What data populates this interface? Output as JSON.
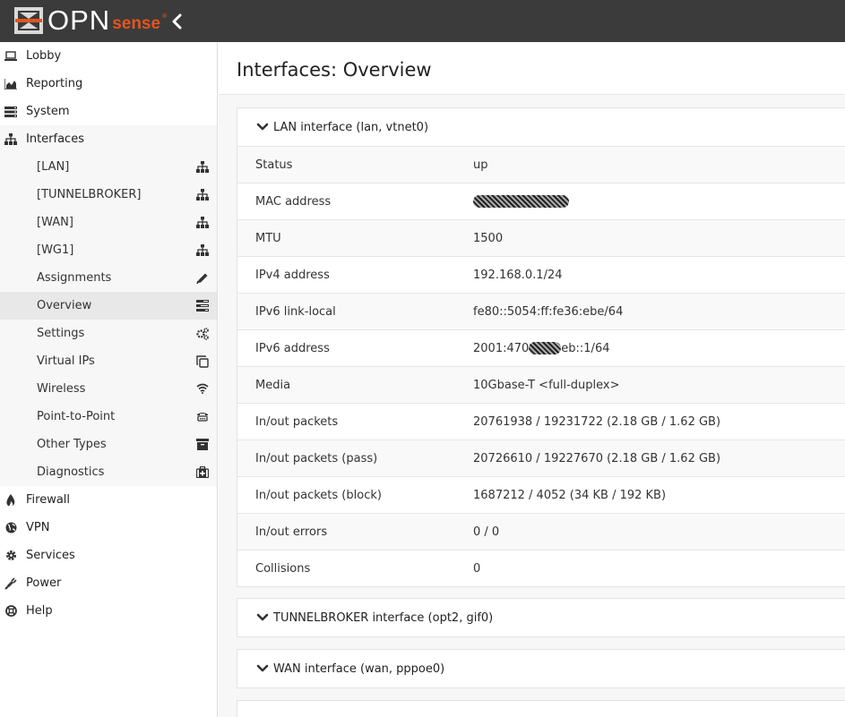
{
  "brand": {
    "name_primary": "OPN",
    "name_secondary": "sense",
    "registered_mark": "®",
    "accent_color": "#e2551f"
  },
  "topbar": {
    "collapse_icon": "chevron-left-icon"
  },
  "sidebar": {
    "items": [
      {
        "label": "Lobby",
        "icon": "laptop-icon"
      },
      {
        "label": "Reporting",
        "icon": "area-chart-icon"
      },
      {
        "label": "System",
        "icon": "server-icon"
      },
      {
        "label": "Interfaces",
        "icon": "sitemap-icon"
      },
      {
        "label": "Firewall",
        "icon": "fire-icon"
      },
      {
        "label": "VPN",
        "icon": "globe-icon"
      },
      {
        "label": "Services",
        "icon": "gear-icon"
      },
      {
        "label": "Power",
        "icon": "plug-icon"
      },
      {
        "label": "Help",
        "icon": "life-ring-icon"
      }
    ],
    "interfaces_sub": [
      {
        "label": "[LAN]",
        "icon": "sitemap-icon"
      },
      {
        "label": "[TUNNELBROKER]",
        "icon": "sitemap-icon"
      },
      {
        "label": "[WAN]",
        "icon": "sitemap-icon"
      },
      {
        "label": "[WG1]",
        "icon": "sitemap-icon"
      },
      {
        "label": "Assignments",
        "icon": "pencil-icon"
      },
      {
        "label": "Overview",
        "icon": "tasks-icon"
      },
      {
        "label": "Settings",
        "icon": "gears-icon"
      },
      {
        "label": "Virtual IPs",
        "icon": "clone-icon"
      },
      {
        "label": "Wireless",
        "icon": "wifi-icon"
      },
      {
        "label": "Point-to-Point",
        "icon": "phone-icon"
      },
      {
        "label": "Other Types",
        "icon": "archive-icon"
      },
      {
        "label": "Diagnostics",
        "icon": "medkit-icon"
      }
    ]
  },
  "main": {
    "title": "Interfaces: Overview",
    "panels": [
      {
        "title": "LAN interface (lan, vtnet0)",
        "expanded": true,
        "rows": [
          {
            "label": "Status",
            "value": "up"
          },
          {
            "label": "MAC address",
            "value": ""
          },
          {
            "label": "MTU",
            "value": "1500"
          },
          {
            "label": "IPv4 address",
            "value": "192.168.0.1/24"
          },
          {
            "label": "IPv6 link-local",
            "value": "fe80::5054:ff:fe36:ebe/64"
          },
          {
            "label": "IPv6 address",
            "value_prefix": "2001:470",
            "value_suffix": "eb::1/64"
          },
          {
            "label": "Media",
            "value": "10Gbase-T <full-duplex>"
          },
          {
            "label": "In/out packets",
            "value": "20761938 / 19231722 (2.18 GB / 1.62 GB)"
          },
          {
            "label": "In/out packets (pass)",
            "value": "20726610 / 19227670 (2.18 GB / 1.62 GB)"
          },
          {
            "label": "In/out packets (block)",
            "value": "1687212 / 4052 (34 KB / 192 KB)"
          },
          {
            "label": "In/out errors",
            "value": "0 / 0"
          },
          {
            "label": "Collisions",
            "value": "0"
          }
        ]
      },
      {
        "title": "TUNNELBROKER interface (opt2, gif0)",
        "expanded": false
      },
      {
        "title": "WAN interface (wan, pppoe0)",
        "expanded": false
      }
    ]
  }
}
